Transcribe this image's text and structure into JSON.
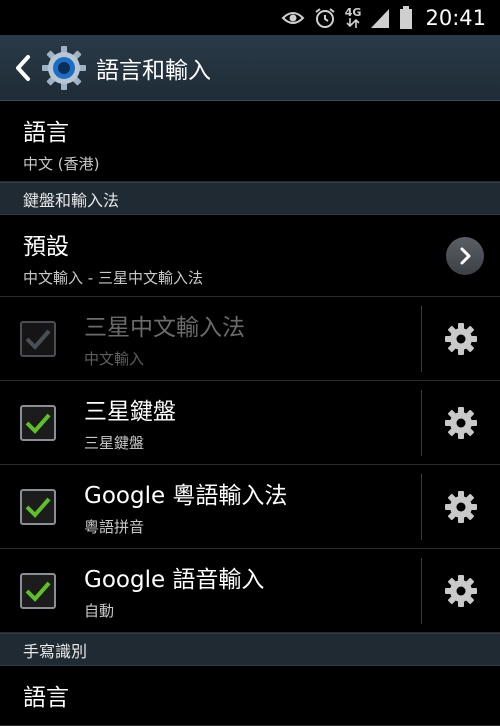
{
  "status_bar": {
    "icons": [
      "eye-icon",
      "alarm-icon",
      "network-4g-icon",
      "signal-icon",
      "battery-icon"
    ],
    "network_label": "4G",
    "time": "20:41"
  },
  "action_bar": {
    "title": "語言和輸入",
    "back_icon": "chevron-left-icon",
    "app_icon": "settings-gear-icon"
  },
  "language": {
    "title": "語言",
    "value": "中文 (香港)"
  },
  "keyboard_section": {
    "header": "鍵盤和輸入法",
    "default": {
      "title": "預設",
      "value": "中文輸入 - 三星中文輸入法"
    },
    "methods": [
      {
        "name": "三星中文輸入法",
        "summary": "中文輸入",
        "checked": true,
        "enabled": false
      },
      {
        "name": "三星鍵盤",
        "summary": "三星鍵盤",
        "checked": true,
        "enabled": true
      },
      {
        "name": "Google 粵語輸入法",
        "summary": "粵語拼音",
        "checked": true,
        "enabled": true
      },
      {
        "name": "Google 語音輸入",
        "summary": "自動",
        "checked": true,
        "enabled": true
      }
    ]
  },
  "handwriting_section": {
    "header": "手寫識別",
    "language_title": "語言"
  },
  "colors": {
    "check_green": "#5fbf2a",
    "header_bg": "#1f2a33",
    "action_bar_bg": "#2a3a48"
  }
}
